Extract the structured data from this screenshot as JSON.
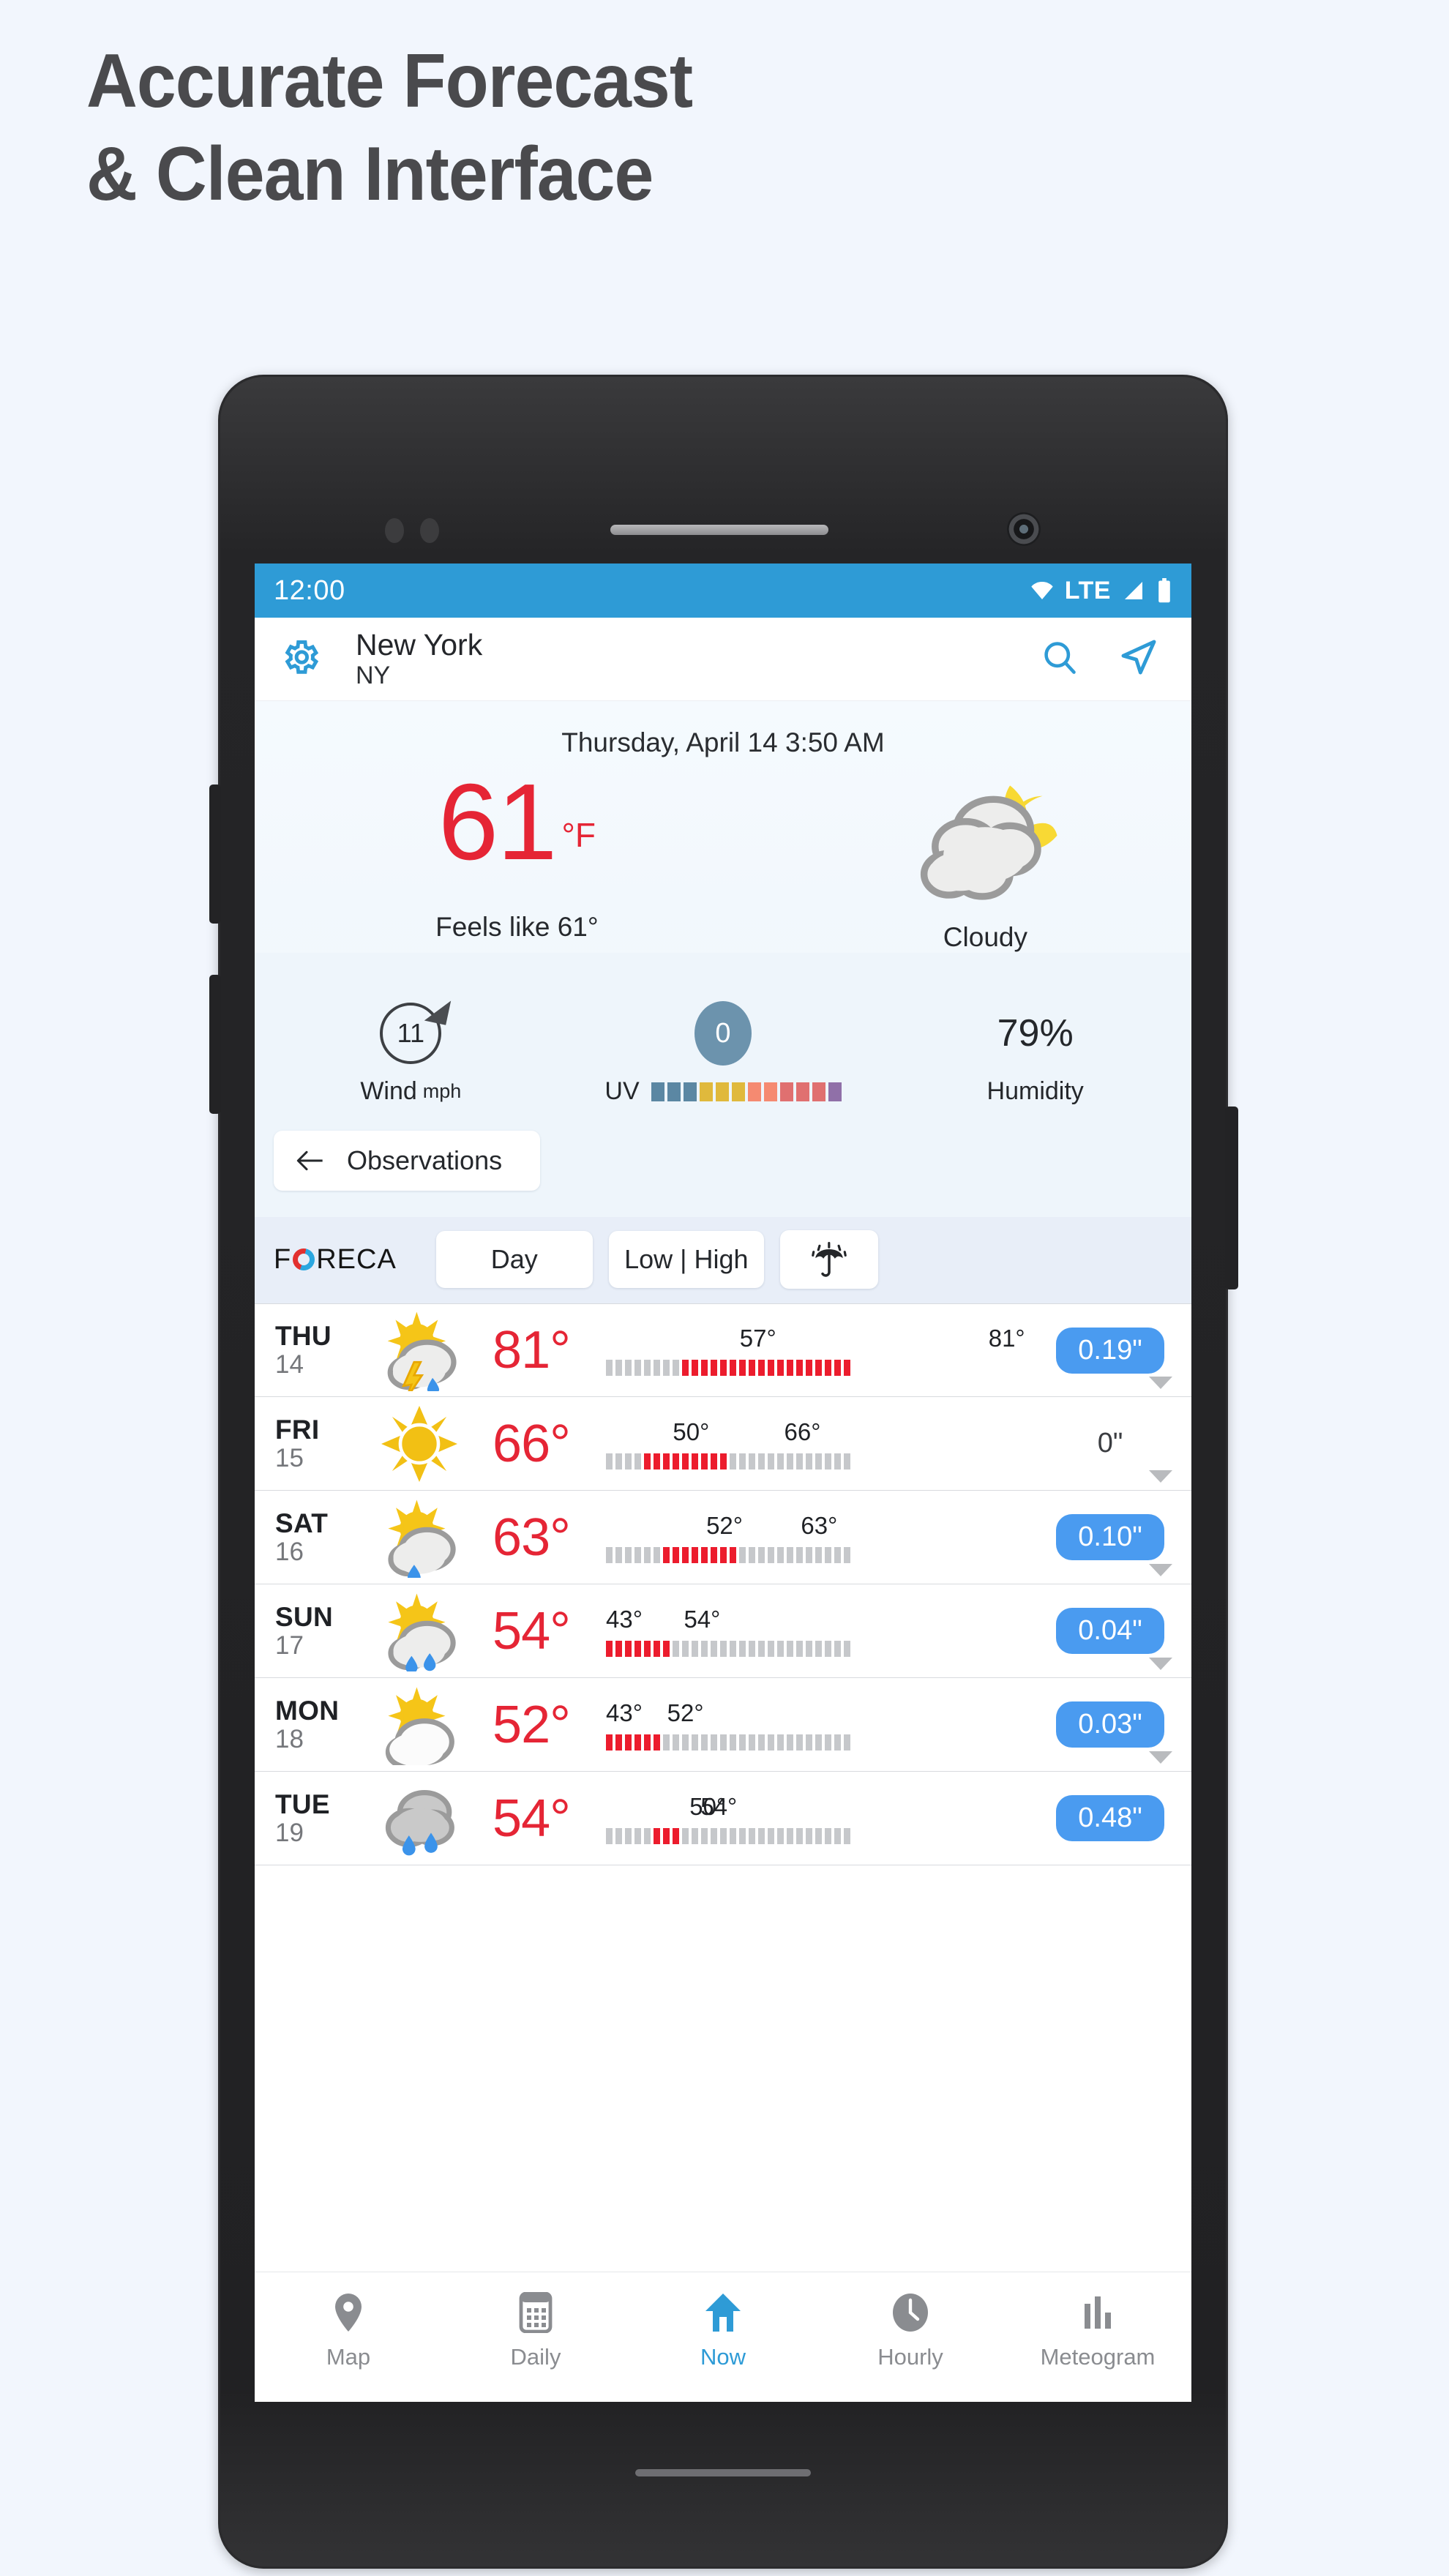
{
  "headline": {
    "line1": "Accurate Forecast",
    "line2": "& Clean Interface"
  },
  "colors": {
    "accent_blue": "#2e9bd6",
    "temp_red": "#e52535",
    "precip_blue": "#4a9bf0",
    "page_bg": "#f2f6fd",
    "headline_gray": "#4a4a4d"
  },
  "status_bar": {
    "time": "12:00",
    "wifi_icon": "wifi-icon",
    "network": "LTE",
    "signal_icon": "signal-icon",
    "battery_icon": "battery-icon"
  },
  "app_bar": {
    "settings_icon": "gear-icon",
    "city": "New York",
    "region": "NY",
    "search_icon": "search-icon",
    "locate_icon": "navigation-arrow-icon"
  },
  "current": {
    "datetime": "Thursday, April 14 3:50 AM",
    "temperature": "61",
    "unit": "°F",
    "feels_like": "Feels like 61°",
    "condition": "Cloudy",
    "condition_icon": "cloudy-night-icon",
    "metrics": {
      "wind": {
        "value": "11",
        "label": "Wind",
        "unit": "mph",
        "icon": "wind-direction-circle-icon"
      },
      "uv": {
        "value": "0",
        "label": "UV",
        "scale_colors": [
          "#5b87a3",
          "#5b87a3",
          "#5b87a3",
          "#e0b93c",
          "#e0b93c",
          "#e0b93c",
          "#f58a71",
          "#f58a71",
          "#e07070",
          "#e07070",
          "#e07070",
          "#9070a8"
        ]
      },
      "humidity": {
        "value": "79%",
        "label": "Humidity"
      }
    },
    "observations_button": {
      "label": "Observations",
      "icon": "arrow-left-icon"
    }
  },
  "foreca_bar": {
    "logo": {
      "pre": "F",
      "o": "O",
      "post": "RECA"
    },
    "tabs": [
      {
        "label": "Day",
        "name": "tab-day"
      },
      {
        "label": "Low | High",
        "name": "tab-low-high"
      }
    ],
    "umbrella_icon": "umbrella-rain-icon"
  },
  "forecast": {
    "rows": [
      {
        "day": "THU",
        "date": "14",
        "icon": "thunderstorm-sun-icon",
        "temp": "81°",
        "low": "57°",
        "high": "81°",
        "bar_gray_lead": 8,
        "bar_red": 18,
        "bar_total": 26,
        "precip": "0.19\"",
        "precip_highlight": true
      },
      {
        "day": "FRI",
        "date": "15",
        "icon": "sunny-icon",
        "temp": "66°",
        "low": "50°",
        "high": "66°",
        "bar_gray_lead": 4,
        "bar_red": 9,
        "bar_total": 26,
        "precip": "0\"",
        "precip_highlight": false
      },
      {
        "day": "SAT",
        "date": "16",
        "icon": "sun-cloud-rain-icon",
        "temp": "63°",
        "low": "52°",
        "high": "63°",
        "bar_gray_lead": 6,
        "bar_red": 8,
        "bar_total": 26,
        "precip": "0.10\"",
        "precip_highlight": true
      },
      {
        "day": "SUN",
        "date": "17",
        "icon": "sun-cloud-showers-icon",
        "temp": "54°",
        "low": "43°",
        "high": "54°",
        "bar_gray_lead": 0,
        "bar_red": 7,
        "bar_total": 26,
        "precip": "0.04\"",
        "precip_highlight": true
      },
      {
        "day": "MON",
        "date": "18",
        "icon": "sun-cloud-icon",
        "temp": "52°",
        "low": "43°",
        "high": "52°",
        "bar_gray_lead": 0,
        "bar_red": 6,
        "bar_total": 26,
        "precip": "0.03\"",
        "precip_highlight": true
      },
      {
        "day": "TUE",
        "date": "19",
        "icon": "rain-cloud-icon",
        "temp": "54°",
        "low": "50°",
        "high": "54°",
        "bar_gray_lead": 5,
        "bar_red": 3,
        "bar_total": 26,
        "precip": "0.48\"",
        "precip_highlight": true
      }
    ]
  },
  "bottom_nav": {
    "items": [
      {
        "label": "Map",
        "icon": "map-pin-icon",
        "active": false
      },
      {
        "label": "Daily",
        "icon": "calendar-icon",
        "active": false
      },
      {
        "label": "Now",
        "icon": "home-icon",
        "active": true
      },
      {
        "label": "Hourly",
        "icon": "clock-icon",
        "active": false
      },
      {
        "label": "Meteogram",
        "icon": "bar-chart-icon",
        "active": false
      }
    ]
  }
}
